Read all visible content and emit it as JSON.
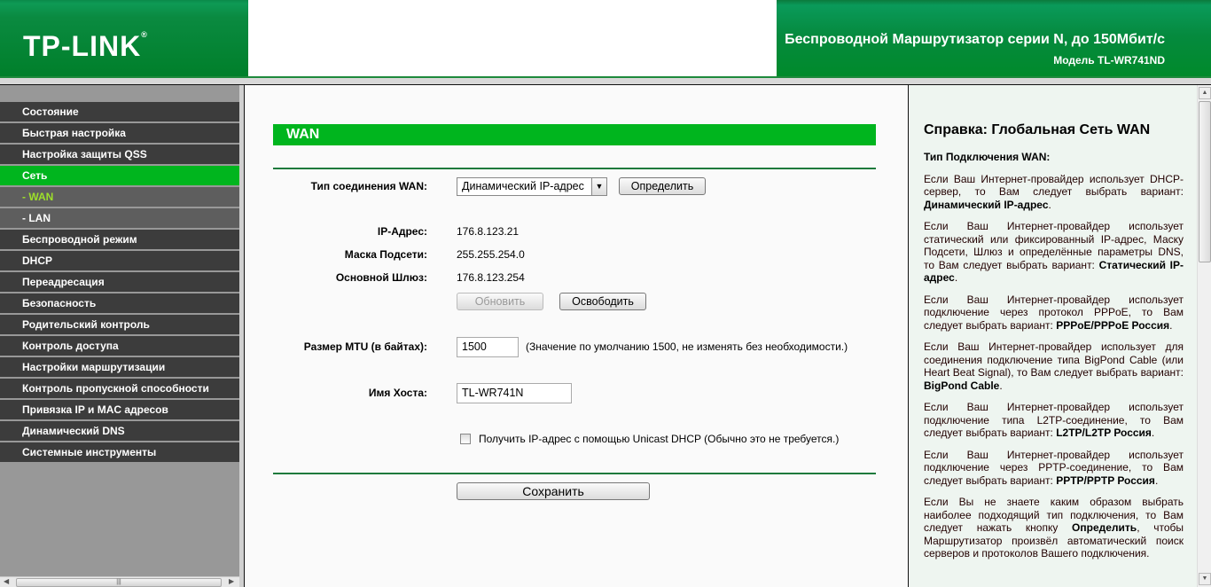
{
  "header": {
    "logo": "TP-LINK",
    "logo_mark": "®",
    "title": "Беспроводной Маршрутизатор серии N, до 150Мбит/с",
    "model": "Модель TL-WR741ND"
  },
  "sidebar": {
    "items": [
      {
        "label": "Состояние"
      },
      {
        "label": "Быстрая настройка"
      },
      {
        "label": "Настройка защиты QSS"
      },
      {
        "label": "Сеть"
      },
      {
        "label": "- WAN"
      },
      {
        "label": "- LAN"
      },
      {
        "label": "Беспроводной режим"
      },
      {
        "label": "DHCP"
      },
      {
        "label": "Переадресация"
      },
      {
        "label": "Безопасность"
      },
      {
        "label": "Родительский контроль"
      },
      {
        "label": "Контроль доступа"
      },
      {
        "label": "Настройки маршрутизации"
      },
      {
        "label": "Контроль пропускной способности"
      },
      {
        "label": "Привязка IP и MAC адресов"
      },
      {
        "label": "Динамический DNS"
      },
      {
        "label": "Системные инструменты"
      }
    ]
  },
  "main": {
    "section_title": "WAN",
    "wan_type_label": "Тип соединения WAN:",
    "wan_type_value": "Динамический IP-адрес",
    "detect_button": "Определить",
    "ip_label": "IP-Адрес:",
    "ip_value": "176.8.123.21",
    "mask_label": "Маска Подсети:",
    "mask_value": "255.255.254.0",
    "gateway_label": "Основной Шлюз:",
    "gateway_value": "176.8.123.254",
    "renew_button": "Обновить",
    "release_button": "Освободить",
    "mtu_label": "Размер MTU (в байтах):",
    "mtu_value": "1500",
    "mtu_hint": "(Значение по умолчанию 1500, не изменять без необходимости.)",
    "host_label": "Имя Хоста:",
    "host_value": "TL-WR741N",
    "unicast_label": "Получить IP-адрес с помощью Unicast DHCP (Обычно это не требуется.)",
    "unicast_checked": false,
    "save_button": "Сохранить"
  },
  "help": {
    "title": "Справка: Глобальная Сеть WAN",
    "subtitle": "Тип Подключения WAN:",
    "paragraphs": [
      {
        "pre": "Если Ваш Интернет-провайдер использует DHCP-сервер, то Вам следует выбрать вариант: ",
        "bold": "Динамический IP-адрес",
        "post": "."
      },
      {
        "pre": "Если Ваш Интернет-провайдер использует статический или фиксированный IP-адрес, Маску Подсети, Шлюз и определённые параметры DNS, то Вам следует выбрать вариант: ",
        "bold": "Статический IP-адрес",
        "post": "."
      },
      {
        "pre": "Если Ваш Интернет-провайдер использует подключение через протокол PPPoE, то Вам следует выбрать вариант: ",
        "bold": "PPPoE/PPPoE Россия",
        "post": "."
      },
      {
        "pre": "Если Ваш Интернет-провайдер использует для соединения подключение типа BigPond Cable (или Heart Beat Signal), то Вам следует выбрать вариант: ",
        "bold": "BigPond Cable",
        "post": "."
      },
      {
        "pre": "Если Ваш Интернет-провайдер использует подключение типа L2TP-соединение, то Вам следует выбрать вариант: ",
        "bold": "L2TP/L2TP Россия",
        "post": "."
      },
      {
        "pre": "Если Ваш Интернет-провайдер использует подключение через PPTP-соединение, то Вам следует выбрать вариант: ",
        "bold": "PPTP/PPTP Россия",
        "post": "."
      },
      {
        "pre": "Если Вы не знаете каким образом выбрать наиболее подходящий тип подключения, то Вам следует нажать кнопку ",
        "bold": "Определить",
        "post": ", чтобы Маршрутизатор произвёл автоматический поиск серверов и протоколов Вашего подключения."
      }
    ]
  },
  "colors": {
    "brand_green": "#008a2a",
    "accent_green": "#00b51e",
    "nav_dark": "#3c3c3c"
  }
}
